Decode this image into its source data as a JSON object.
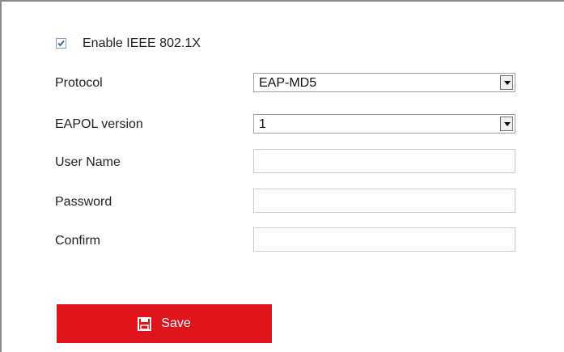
{
  "form": {
    "enable_8021x": {
      "label": "Enable IEEE 802.1X",
      "checked": true
    },
    "protocol": {
      "label": "Protocol",
      "value": "EAP-MD5"
    },
    "eapol_version": {
      "label": "EAPOL version",
      "value": "1"
    },
    "user_name": {
      "label": "User Name",
      "value": "",
      "placeholder": ""
    },
    "password": {
      "label": "Password",
      "value": "",
      "placeholder": ""
    },
    "confirm": {
      "label": "Confirm",
      "value": "",
      "placeholder": ""
    }
  },
  "actions": {
    "save_label": "Save",
    "save_icon": "floppy-disk-icon",
    "save_color": "#e0141b"
  }
}
